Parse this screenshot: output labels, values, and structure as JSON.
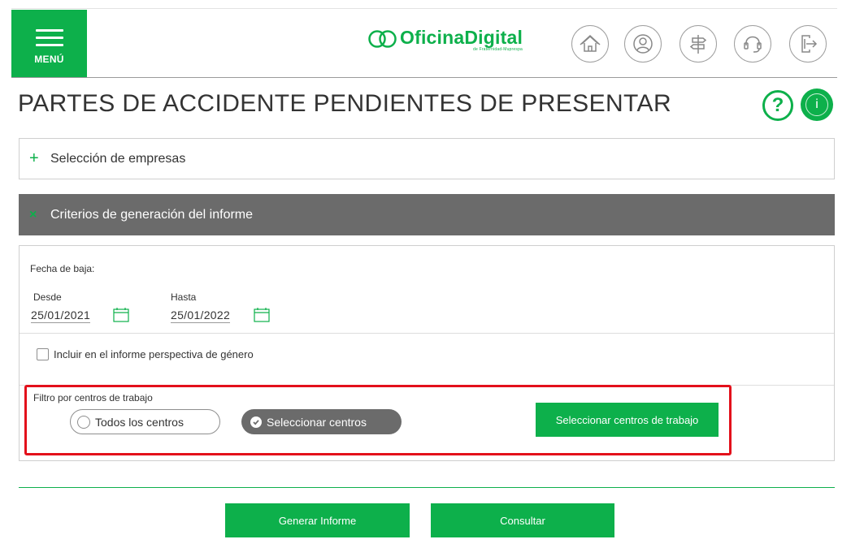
{
  "header": {
    "menu_label": "MENÚ",
    "logo_main": "OficinaDigital",
    "logo_sub": "de Fraternidad-Muprespa",
    "icons": [
      "home-icon",
      "user-icon",
      "signpost-icon",
      "headset-icon",
      "logout-icon"
    ]
  },
  "page": {
    "title": "PARTES DE ACCIDENTE PENDIENTES DE PRESENTAR",
    "help_symbol": "?",
    "info_symbol": "i"
  },
  "sections": {
    "empresas": {
      "symbol": "+",
      "label": "Selección de empresas"
    },
    "criterios": {
      "symbol": "×",
      "label": "Criterios de generación del informe"
    }
  },
  "form": {
    "fecha_label": "Fecha de baja:",
    "desde_label": "Desde",
    "desde_value": "25/01/2021",
    "hasta_label": "Hasta",
    "hasta_value": "25/01/2022",
    "genero_label": "Incluir en el informe perspectiva de género",
    "genero_checked": false,
    "filtro_label": "Filtro por centros de trabajo",
    "radio_todos": "Todos los centros",
    "radio_seleccionar": "Seleccionar centros",
    "selected_radio": "Seleccionar centros",
    "btn_seleccionar_centros": "Seleccionar centros de trabajo"
  },
  "actions": {
    "generar": "Generar Informe",
    "consultar": "Consultar"
  },
  "colors": {
    "brand_green": "#0db04b",
    "section_gray": "#6b6b6b",
    "highlight_red": "#e3101b"
  }
}
